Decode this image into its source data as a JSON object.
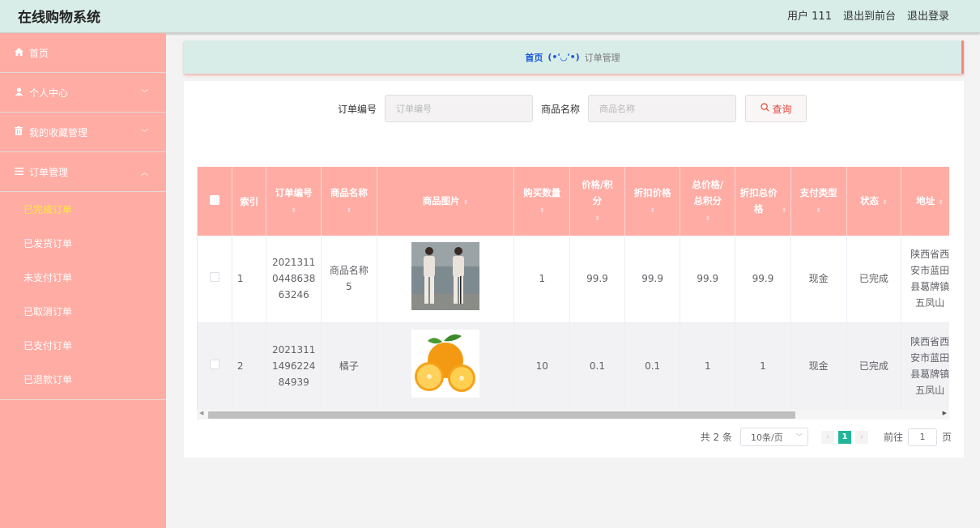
{
  "app": {
    "title": "在线购物系统"
  },
  "topbar": {
    "user": "用户 111",
    "to_front": "退出到前台",
    "logout": "退出登录"
  },
  "sidebar": {
    "items": [
      {
        "label": "首页",
        "icon": "home-icon"
      },
      {
        "label": "个人中心",
        "icon": "user-icon"
      },
      {
        "label": "我的收藏管理",
        "icon": "trash-icon"
      },
      {
        "label": "订单管理",
        "icon": "list-icon"
      }
    ],
    "sub_items": [
      "已完成订单",
      "已发货订单",
      "未支付订单",
      "已取消订单",
      "已支付订单",
      "已退款订单"
    ],
    "active_sub": "已完成订单"
  },
  "breadcrumb": {
    "home": "首页",
    "face": "(•'◡'•)",
    "current": "订单管理"
  },
  "search": {
    "order_no_label": "订单编号",
    "order_no_placeholder": "订单编号",
    "product_label": "商品名称",
    "product_placeholder": "商品名称",
    "query_label": "查询"
  },
  "table": {
    "headers": [
      "索引",
      "订单编号",
      "商品名称",
      "商品图片",
      "购买数量",
      "价格/积分",
      "折扣价格",
      "总价格/总积分",
      "折扣总价格",
      "支付类型",
      "状态",
      "地址"
    ],
    "rows": [
      {
        "index": "1",
        "order_no": "20213110448638 63246",
        "order_no_lines": [
          "2021311",
          "0448638",
          "63246"
        ],
        "product": "商品名称5",
        "product_lines": [
          "商品名称",
          "5"
        ],
        "image": "clothing-photo",
        "qty": "1",
        "price": "99.9",
        "discount_price": "99.9",
        "total": "99.9",
        "discount_total": "99.9",
        "pay_type": "现金",
        "status": "已完成",
        "address_lines": [
          "陕西省西",
          "安市蓝田",
          "县葛牌镇",
          "五凤山"
        ]
      },
      {
        "index": "2",
        "order_no": "2021311149622484939",
        "order_no_lines": [
          "2021311",
          "1496224",
          "84939"
        ],
        "product": "橘子",
        "product_lines": [
          "橘子"
        ],
        "image": "orange-photo",
        "qty": "10",
        "price": "0.1",
        "discount_price": "0.1",
        "total": "1",
        "discount_total": "1",
        "pay_type": "现金",
        "status": "已完成",
        "address_lines": [
          "陕西省西",
          "安市蓝田",
          "县葛牌镇",
          "五凤山"
        ]
      }
    ]
  },
  "pagination": {
    "total": "共 2 条",
    "page_size": "10条/页",
    "current_page": "1",
    "goto_label": "前往",
    "goto_value": "1",
    "page_suffix": "页"
  },
  "colors": {
    "sidebar": "#ffaca4",
    "header_bar": "#d9ede8",
    "accent": "#21b69a",
    "active_sub": "#ffeb3b"
  }
}
